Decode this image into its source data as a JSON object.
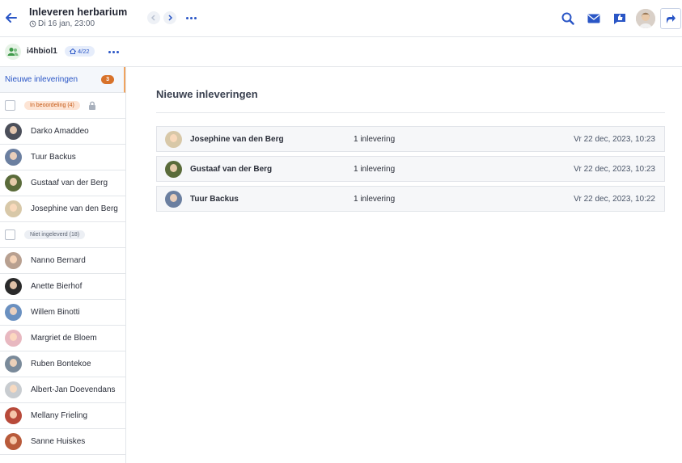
{
  "header": {
    "title": "Inleveren herbarium",
    "due": "Di 16 jan, 23:00"
  },
  "group": {
    "name": "i4hbiol1",
    "badge": "4/22"
  },
  "sidebar": {
    "new_label": "Nieuwe inleveringen",
    "new_count": "3",
    "review_label": "In beoordeling (4)",
    "review_students": [
      {
        "name": "Darko Amaddeo",
        "color": "#4b4f5a"
      },
      {
        "name": "Tuur Backus",
        "color": "#6b7fa0"
      },
      {
        "name": "Gustaaf van der Berg",
        "color": "#5a6b3a"
      },
      {
        "name": "Josephine van den Berg",
        "color": "#d8c8a8"
      }
    ],
    "not_submitted_label": "Niet ingeleverd (18)",
    "not_submitted_students": [
      {
        "name": "Nanno Bernard",
        "color": "#b8a090"
      },
      {
        "name": "Anette Bierhof",
        "color": "#2a2a2a"
      },
      {
        "name": "Willem Binotti",
        "color": "#6a90c0"
      },
      {
        "name": "Margriet de Bloem",
        "color": "#e8b8c0"
      },
      {
        "name": "Ruben Bontekoe",
        "color": "#7a8a9a"
      },
      {
        "name": "Albert-Jan Doevendans",
        "color": "#c8ccd0"
      },
      {
        "name": "Mellany Frieling",
        "color": "#b84a3a"
      },
      {
        "name": "Sanne Huiskes",
        "color": "#b85a3a"
      }
    ]
  },
  "main": {
    "title": "Nieuwe inleveringen",
    "submissions": [
      {
        "name": "Josephine van den Berg",
        "count": "1 inlevering",
        "date": "Vr 22 dec, 2023, 10:23",
        "color": "#d8c8a8"
      },
      {
        "name": "Gustaaf van der Berg",
        "count": "1 inlevering",
        "date": "Vr 22 dec, 2023, 10:23",
        "color": "#5a6b3a"
      },
      {
        "name": "Tuur Backus",
        "count": "1 inlevering",
        "date": "Vr 22 dec, 2023, 10:22",
        "color": "#6b7fa0"
      }
    ]
  },
  "colors": {
    "accent": "#2a56c6",
    "badge_orange": "#d8722a"
  }
}
